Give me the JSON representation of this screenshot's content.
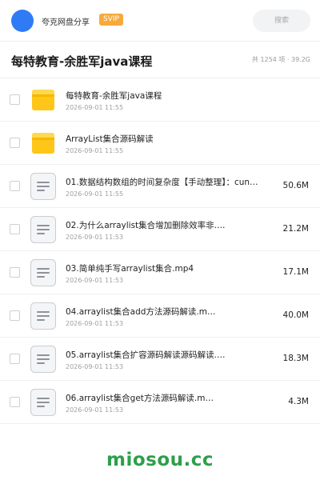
{
  "header": {
    "app_name": "夸克网盘分享",
    "badge": "SVIP",
    "search_placeholder": "搜索",
    "avatar_color": "#2f7bf5",
    "badge_color": "#f7a93b"
  },
  "folder": {
    "title": "每特教育-余胜军java课程",
    "summary": "共 1254 项 · 39.2G"
  },
  "files": [
    {
      "type": "folder",
      "name": "每特教育-余胜军java课程",
      "date": "2026-09-01 11:55",
      "size": ""
    },
    {
      "type": "folder",
      "name": "ArrayList集合源码解读",
      "date": "2026-09-01 11:55",
      "size": ""
    },
    {
      "type": "file",
      "name": "01.数据结构数组的时间复杂度【手动整理】：cun…",
      "date": "2026-09-01 11:55",
      "size": "50.6M"
    },
    {
      "type": "file",
      "name": "02.为什么arraylist集合增加删除效率非.…",
      "date": "2026-09-01 11:53",
      "size": "21.2M"
    },
    {
      "type": "file",
      "name": "03.简单纯手写arraylist集合.mp4",
      "date": "2026-09-01 11:53",
      "size": "17.1M"
    },
    {
      "type": "file",
      "name": "04.arraylist集合add方法源码解读.m…",
      "date": "2026-09-01 11:53",
      "size": "40.0M"
    },
    {
      "type": "file",
      "name": "05.arraylist集合扩容源码解读源码解读.…",
      "date": "2026-09-01 11:53",
      "size": "18.3M"
    },
    {
      "type": "file",
      "name": "06.arraylist集合get方法源码解读.m…",
      "date": "2026-09-01 11:53",
      "size": "4.3M"
    }
  ],
  "watermark": "miosou.cc",
  "colors": {
    "folder": "#ffc61a",
    "folder_tab": "#ffd84d",
    "brand": "#2e9f4a"
  }
}
